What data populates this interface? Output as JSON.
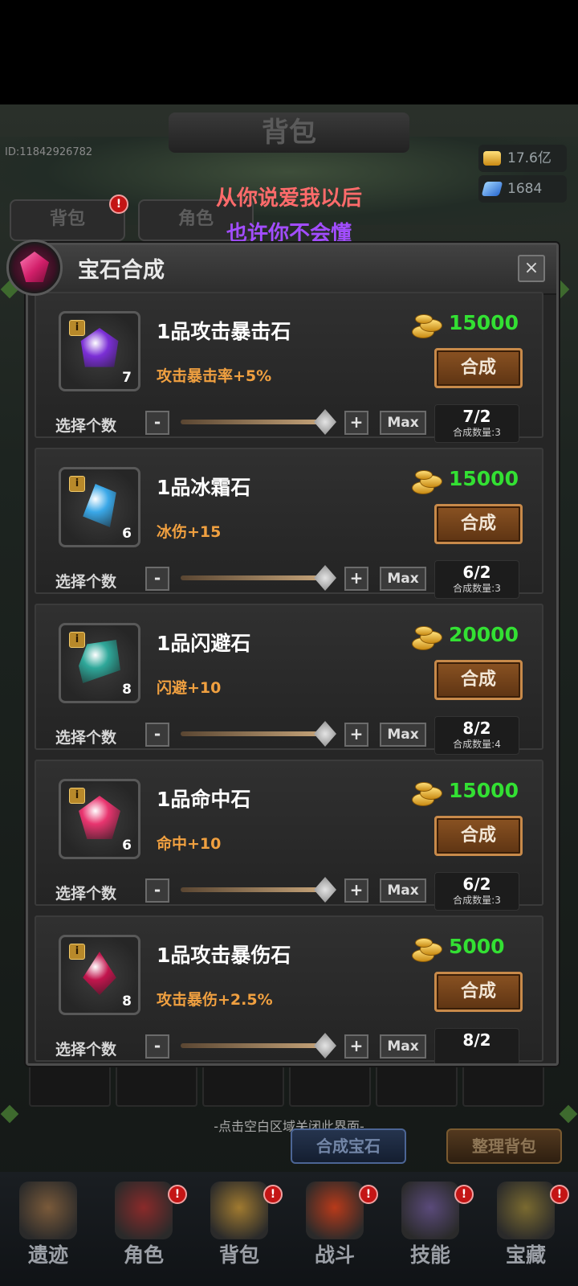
{
  "header": {
    "title": "背包",
    "uid": "ID:11842926782",
    "gold": "17.6亿",
    "gems": "1684",
    "tabs": [
      "背包",
      "角色"
    ]
  },
  "overlay_lyrics": [
    "从你说爱我以后",
    "也许你不会懂"
  ],
  "panel": {
    "title": "宝石合成",
    "close": "×",
    "select_label": "选择个数",
    "minus": "-",
    "plus": "+",
    "max": "Max",
    "compose": "合成",
    "items": [
      {
        "name": "1品攻击暴击石",
        "effect": "攻击暴击率+5%",
        "count": "7",
        "cost": "15000",
        "ratio": "7/2",
        "output": "合成数量:3",
        "color": "#7b2fd6"
      },
      {
        "name": "1品冰霜石",
        "effect": "冰伤+15",
        "count": "6",
        "cost": "15000",
        "ratio": "6/2",
        "output": "合成数量:3",
        "color": "#3aa8e8"
      },
      {
        "name": "1品闪避石",
        "effect": "闪避+10",
        "count": "8",
        "cost": "20000",
        "ratio": "8/2",
        "output": "合成数量:4",
        "color": "#2fa89a"
      },
      {
        "name": "1品命中石",
        "effect": "命中+10",
        "count": "6",
        "cost": "15000",
        "ratio": "6/2",
        "output": "合成数量:3",
        "color": "#e8356f"
      },
      {
        "name": "1品攻击暴伤石",
        "effect": "攻击暴伤+2.5%",
        "count": "8",
        "cost": "5000",
        "ratio": "8/2",
        "output": "",
        "color": "#c2154d"
      }
    ]
  },
  "hint": "-点击空白区域关闭此界面-",
  "bottom_buttons": [
    "合成宝石",
    "整理背包"
  ],
  "nav": [
    "遗迹",
    "角色",
    "背包",
    "战斗",
    "技能",
    "宝藏"
  ],
  "badge": "!"
}
